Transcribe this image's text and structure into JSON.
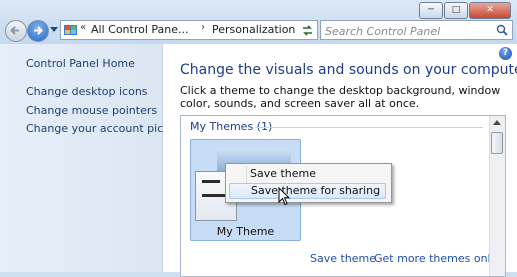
{
  "window": {
    "minimize": "─",
    "maximize": "□",
    "close": "✕"
  },
  "address": {
    "prefix": "«",
    "crumbs": [
      "All Control Pane...",
      "Personalization"
    ],
    "separator": "›"
  },
  "search": {
    "placeholder": "Search Control Panel"
  },
  "sidebar": {
    "items": [
      {
        "label": "Control Panel Home"
      },
      {
        "label": "Change desktop icons"
      },
      {
        "label": "Change mouse pointers"
      },
      {
        "label": "Change your account picture"
      }
    ]
  },
  "main": {
    "help": "?",
    "heading": "Change the visuals and sounds on your computer",
    "description": "Click a theme to change the desktop background, window color, sounds, and screen saver all at once.",
    "group_header": "My Themes (1)",
    "theme_name": "My Theme",
    "save_link": "Save theme",
    "online_link": "Get more themes online"
  },
  "context_menu": {
    "items": [
      {
        "label": "Save theme"
      },
      {
        "label": "Save theme for sharing"
      }
    ],
    "highlighted": "Save theme for sharing"
  },
  "colors": {
    "heading": "#1e3e8a",
    "link": "#1e4fb0",
    "chrome": "#cfdff0"
  }
}
